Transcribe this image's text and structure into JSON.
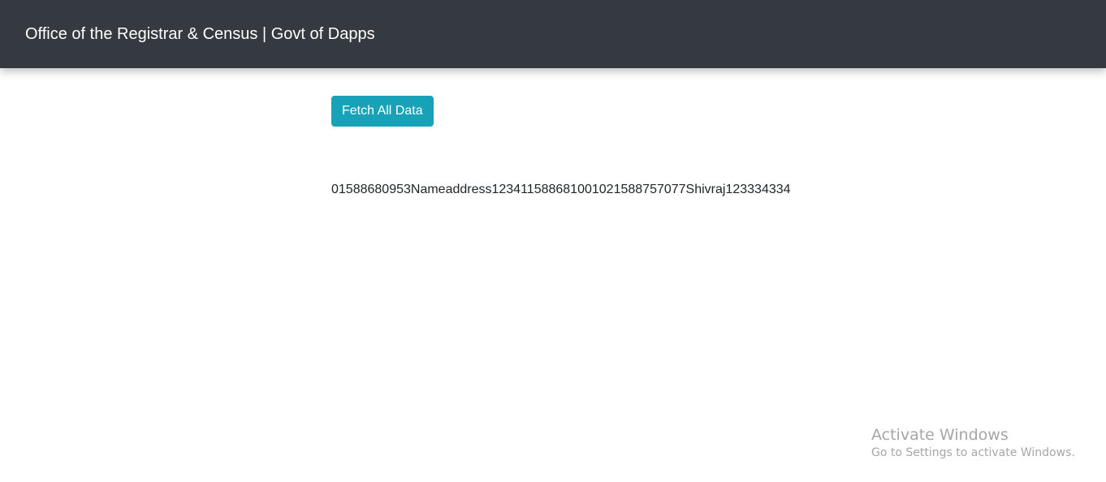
{
  "navbar": {
    "brand": "Office of the Registrar & Census | Govt of Dapps"
  },
  "main": {
    "fetch_button_label": "Fetch All Data",
    "data_output": "01588680953Nameaddress1234115886810010215887570 77Shivraj123334334"
  },
  "watermark": {
    "title": "Activate Windows",
    "subtitle": "Go to Settings to activate Windows."
  },
  "colors": {
    "navbar_bg": "#343a40",
    "button_bg": "#17a2b8",
    "watermark_text": "#a6a6a6"
  }
}
